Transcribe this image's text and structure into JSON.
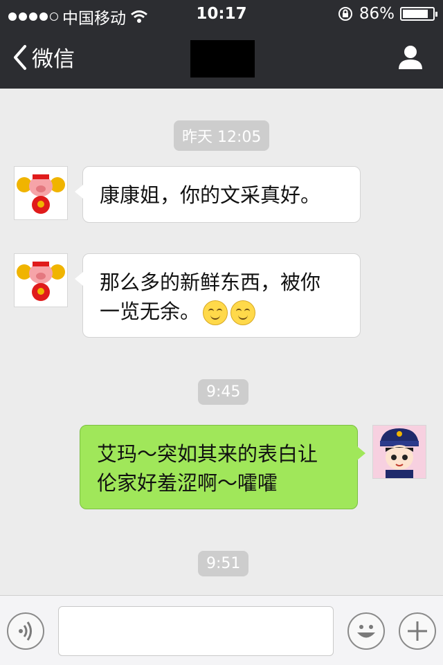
{
  "status_bar": {
    "carrier": "中国移动",
    "time": "10:17",
    "battery": "86%",
    "battery_level": 0.86
  },
  "nav": {
    "back_label": "微信"
  },
  "messages": [
    {
      "timestamp": "昨天 12:05"
    },
    {
      "text": "康康姐，你的文采真好。"
    },
    {
      "line1": "那么多的新鲜东西，被你",
      "line2": "一览无余。"
    },
    {
      "timestamp": "9:45"
    },
    {
      "line1": "艾玛～突如其来的表白让",
      "line2": "伦家好羞涩啊～嚯嚯"
    },
    {
      "timestamp": "9:51"
    }
  ],
  "colors": {
    "header_bg": "#2c2d31",
    "chat_bg": "#ececec",
    "outgoing_bubble": "#a0e75a",
    "incoming_bubble": "#ffffff"
  },
  "icons": {
    "back": "chevron-left-icon",
    "profile": "user-icon",
    "voice": "voice-icon",
    "emoji": "emoji-icon",
    "plus": "plus-icon"
  }
}
